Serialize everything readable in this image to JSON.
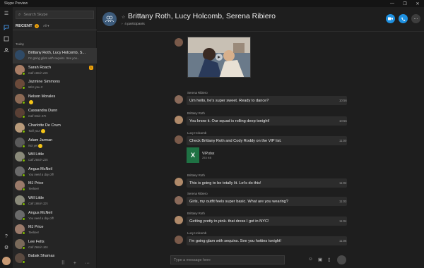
{
  "window": {
    "title": "Skype Preview",
    "controls": [
      "—",
      "❐",
      "✕"
    ]
  },
  "rail": {
    "icons": [
      "menu-icon",
      "chats-icon",
      "contacts-icon",
      "calls-icon",
      "help-icon",
      "settings-icon"
    ]
  },
  "search": {
    "placeholder": "Search Skype",
    "icon": "⌕"
  },
  "recent": {
    "label": "RECENT",
    "badge": "1",
    "filter": "All ▾"
  },
  "section": {
    "today": "Today"
  },
  "conversations": [
    {
      "name": "Brittany Roth, Lucy Holcomb, S...",
      "sub": "I'm going glam with sequins. See you...",
      "color": "#2f4a66",
      "selected": true
    },
    {
      "name": "Sarah Roach",
      "sub": "Call 18min 23s",
      "color": "#a87d65",
      "unread": "1"
    },
    {
      "name": "Jazmine Simmons",
      "sub": "Miss you X",
      "color": "#6b4a3a"
    },
    {
      "name": "Nelson Morales",
      "sub": "",
      "color": "#8c6a55"
    },
    {
      "name": "Cassandra Dunn",
      "sub": "Call 5min 47s",
      "color": "#5a4035"
    },
    {
      "name": "Charlotte De Crum",
      "sub": "Told you!",
      "color": "#b89a7a"
    },
    {
      "name": "Adam Jarman",
      "sub": "Not yet",
      "color": "#5a5a5a"
    },
    {
      "name": "Will Little",
      "sub": "Call 26min 23s",
      "color": "#8a8a7a"
    },
    {
      "name": "Angus McNeil",
      "sub": "You need a day off!",
      "color": "#6a6a6a"
    },
    {
      "name": "MJ Price",
      "sub": "Teehee!",
      "color": "#9a7a6a"
    },
    {
      "name": "Will Little",
      "sub": "Call 18min 32s",
      "color": "#8a8a7a"
    },
    {
      "name": "Angus McNeil",
      "sub": "You need a day off!",
      "color": "#6a6a6a"
    },
    {
      "name": "MJ Price",
      "sub": "Teehee!",
      "color": "#9a7a6a"
    },
    {
      "name": "Lee Felts",
      "sub": "Call 26min 16s",
      "color": "#7a6a5a"
    },
    {
      "name": "Babak Shamas",
      "sub": "",
      "color": "#5a4a40"
    }
  ],
  "chat": {
    "title": "Brittany Roth, Lucy Holcomb, Serena Ribiero",
    "participants": "4 participants",
    "messages": [
      {
        "sender": "Serena Ribiero",
        "text": "Um hello, he's super sweet. Ready to dance?",
        "time": "10:56",
        "color": "#8a6a5a"
      },
      {
        "sender": "Brittany Roth",
        "text": "You know it. Our squad is rolling deep tonight!",
        "time": "10:56",
        "color": "#b08a6a"
      },
      {
        "sender": "Lucy Holcomb",
        "text": "Check Brittany Roth and Cody Roddy on the VIP list.",
        "time": "11:00",
        "color": "#7a5a4a"
      },
      {
        "sender": "Brittany Roth",
        "text": "This is going to be totally lit. Let's do this!",
        "time": "11:02",
        "color": "#b08a6a"
      },
      {
        "sender": "Serena Ribiero",
        "text": "Girls, my outfit feels super basic. What are you wearing?",
        "time": "11:03",
        "color": "#8a6a5a"
      },
      {
        "sender": "Brittany Roth",
        "text": "Getting pretty in pink- that dress I got in NYC!",
        "time": "11:04",
        "color": "#b08a6a"
      },
      {
        "sender": "Lucy Holcomb",
        "text": "I'm going glam with sequins. See you hotties tonight!",
        "time": "11:06",
        "color": "#7a5a4a"
      }
    ],
    "file": {
      "name": "VIP.xlsx",
      "size": "253 KB"
    },
    "composer_placeholder": "Type a message here"
  },
  "colors": {
    "accent": "#0078d7",
    "excel": "#1f7244",
    "unread": "#f0a30a",
    "online": "#7fba00"
  }
}
